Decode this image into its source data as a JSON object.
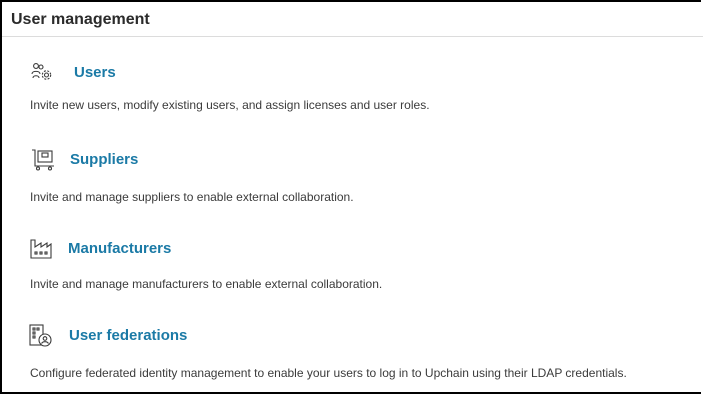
{
  "header": {
    "title": "User management"
  },
  "items": [
    {
      "icon": "users-gear-icon",
      "label": "Users",
      "description": "Invite new users, modify existing users, and assign licenses and user roles."
    },
    {
      "icon": "supplier-cart-icon",
      "label": "Suppliers",
      "description": "Invite and manage suppliers to enable external collaboration."
    },
    {
      "icon": "factory-icon",
      "label": "Manufacturers",
      "description": "Invite and manage manufacturers to enable external collaboration."
    },
    {
      "icon": "user-federation-icon",
      "label": "User federations",
      "description": "Configure federated identity management to enable your users to log in to Upchain using their LDAP credentials."
    }
  ],
  "colors": {
    "link": "#1b7aa6",
    "text": "#3b3b3b",
    "border": "#000000",
    "divider": "#dcdcdc"
  }
}
